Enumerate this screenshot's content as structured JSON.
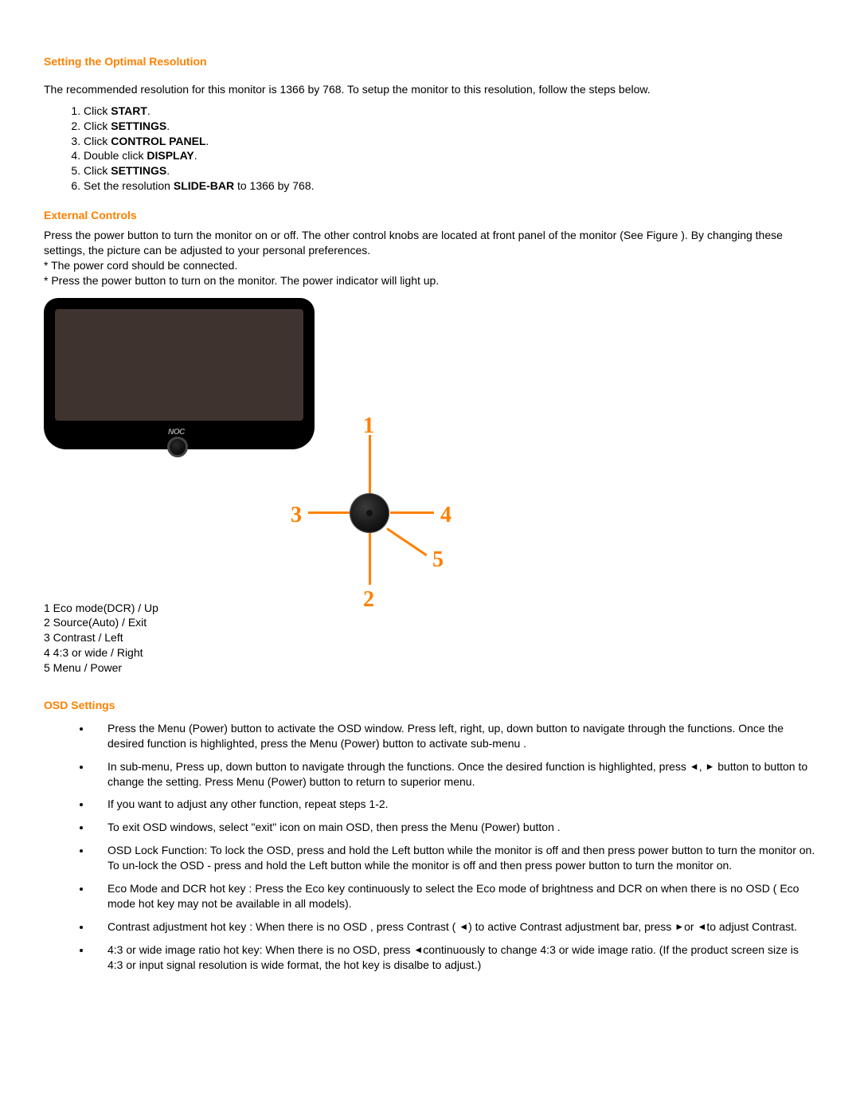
{
  "s1": {
    "heading": "Setting the Optimal Resolution",
    "intro": "The recommended resolution for this monitor is 1366 by 768. To setup the monitor to this resolution, follow the steps below.",
    "steps": [
      {
        "pre": "Click ",
        "bold": "START",
        "post": "."
      },
      {
        "pre": "Click ",
        "bold": "SETTINGS",
        "post": "."
      },
      {
        "pre": "Click ",
        "bold": "CONTROL PANEL",
        "post": "."
      },
      {
        "pre": "Double click ",
        "bold": "DISPLAY",
        "post": "."
      },
      {
        "pre": "Click ",
        "bold": "SETTINGS",
        "post": "."
      },
      {
        "pre": "Set the resolution ",
        "bold": "SLIDE-BAR",
        "post": " to 1366 by 768."
      }
    ]
  },
  "s2": {
    "heading": "External Controls",
    "p1": "Press the power button to turn the monitor on or off. The other control knobs are located at front panel of the monitor (See Figure ). By changing these settings, the picture can be adjusted to your personal preferences.",
    "p2": "* The power cord should be connected.",
    "p3": "* Press the power button to turn on the monitor. The power indicator will light up.",
    "monitor_logo": "NOC",
    "dnums": {
      "n1": "1",
      "n2": "2",
      "n3": "3",
      "n4": "4",
      "n5": "5"
    },
    "legend": [
      "1  Eco mode(DCR) / Up",
      "2  Source(Auto) / Exit",
      "3  Contrast / Left",
      "4  4:3 or wide / Right",
      "5  Menu / Power"
    ]
  },
  "s3": {
    "heading": "OSD Settings",
    "bullets": [
      {
        "segs": [
          {
            "t": "Press the Menu (Power) button to activate the OSD window. Press left, right, up, down button to navigate through the functions. Once the desired function is highlighted, press the Menu (Power) button to activate sub-menu ."
          }
        ]
      },
      {
        "segs": [
          {
            "t": "In sub-menu, Press up, down button to navigate through the functions. Once the desired function is highlighted, press  "
          },
          {
            "icon": "◄"
          },
          {
            "t": ",  "
          },
          {
            "icon": "►"
          },
          {
            "t": " button to button to change the setting. Press Menu (Power) button to return to superior menu."
          }
        ]
      },
      {
        "segs": [
          {
            "t": "If you want to adjust any other function, repeat steps 1-2."
          }
        ]
      },
      {
        "segs": [
          {
            "t": "To exit  OSD windows, select \"exit\" icon on main OSD, then press the Menu (Power) button ."
          }
        ]
      },
      {
        "segs": [
          {
            "t": "OSD Lock Function: To lock the OSD, press and hold the Left button while the monitor is off and then press power button to turn the monitor on. To un-lock the OSD - press and hold the Left button while the monitor is off and then press power button to turn the monitor on."
          }
        ]
      },
      {
        "segs": [
          {
            "t": "Eco Mode and DCR hot key : Press the Eco key continuously to select the Eco mode of brightness and DCR on when there is no OSD ( Eco mode hot key may not be available in all models)."
          }
        ]
      },
      {
        "segs": [
          {
            "t": "Contrast adjustment hot key : When there is no OSD , press Contrast ( "
          },
          {
            "icon": "◄"
          },
          {
            "t": ") to active Contrast adjustment bar, press  "
          },
          {
            "icon": "►"
          },
          {
            "t": "or  "
          },
          {
            "icon": "◄"
          },
          {
            "t": "to adjust Contrast."
          }
        ]
      },
      {
        "segs": [
          {
            "t": "4:3 or wide image ratio hot key: When there is no OSD, press  "
          },
          {
            "icon": "◄"
          },
          {
            "t": "continuously to change 4:3 or wide image ratio. (If the product screen size is 4:3 or input signal resolution is wide format, the hot key is disalbe to adjust.)"
          }
        ]
      }
    ]
  }
}
